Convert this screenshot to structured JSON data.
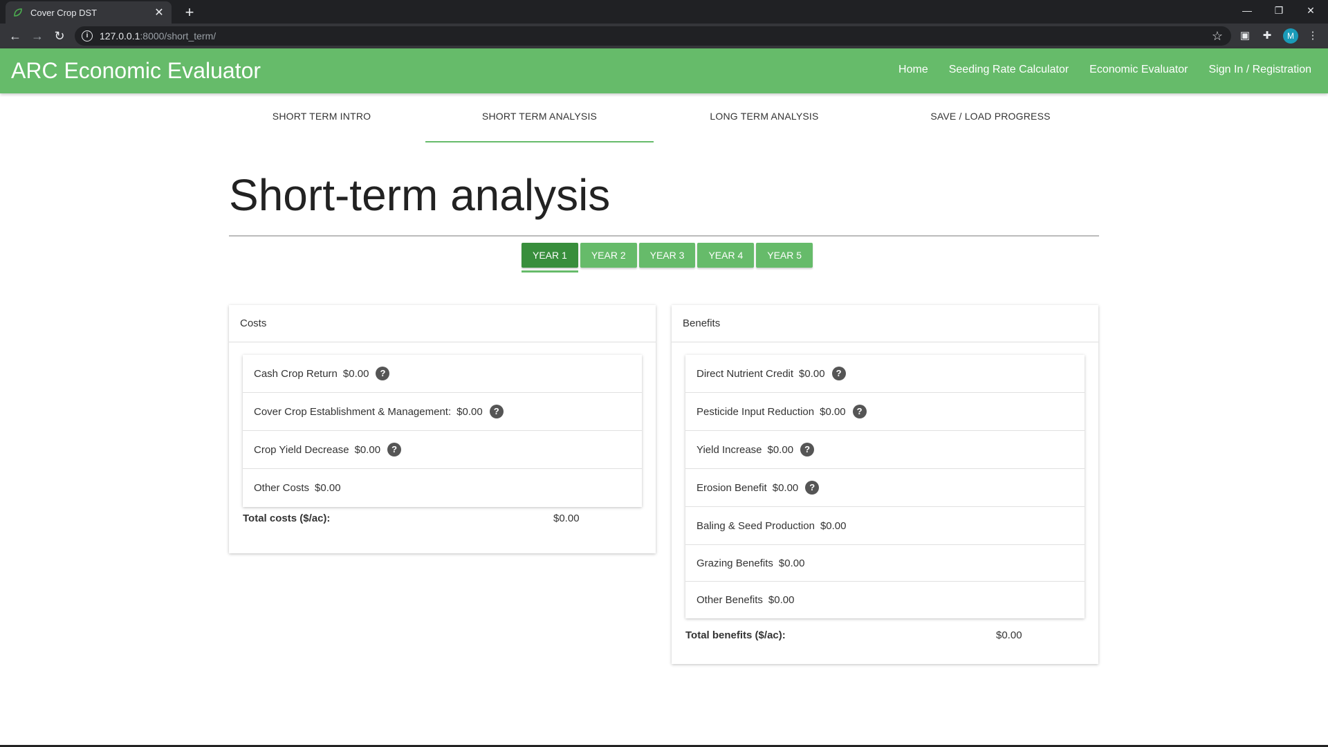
{
  "browser": {
    "tab_title": "Cover Crop DST",
    "tab_close": "✕",
    "new_tab": "+",
    "url_host": "127.0.0.1",
    "url_path": ":8000/short_term/",
    "profile_initial": "M"
  },
  "header": {
    "brand": "ARC Economic Evaluator",
    "links": [
      "Home",
      "Seeding Rate Calculator",
      "Economic Evaluator",
      "Sign In / Registration"
    ]
  },
  "subtabs": [
    "SHORT TERM INTRO",
    "SHORT TERM ANALYSIS",
    "LONG TERM ANALYSIS",
    "SAVE / LOAD PROGRESS"
  ],
  "active_subtab": "SHORT TERM ANALYSIS",
  "page_title": "Short-term analysis",
  "years": [
    "YEAR 1",
    "YEAR 2",
    "YEAR 3",
    "YEAR 4",
    "YEAR 5"
  ],
  "active_year": "YEAR 1",
  "costs": {
    "title": "Costs",
    "items": [
      {
        "label": "Cash Crop Return",
        "value": "$0.00",
        "help": "?"
      },
      {
        "label": "Cover Crop Establishment & Management:",
        "value": "$0.00",
        "help": "?"
      },
      {
        "label": "Crop Yield Decrease",
        "value": "$0.00",
        "help": "?"
      },
      {
        "label": "Other Costs",
        "value": "$0.00"
      }
    ],
    "total_label": "Total costs ($/ac):",
    "total_value": "$0.00"
  },
  "benefits": {
    "title": "Benefits",
    "items": [
      {
        "label": "Direct Nutrient Credit",
        "value": "$0.00",
        "help": "?"
      },
      {
        "label": "Pesticide Input Reduction",
        "value": "$0.00",
        "help": "?"
      },
      {
        "label": "Yield Increase",
        "value": "$0.00",
        "help": "?"
      },
      {
        "label": "Erosion Benefit",
        "value": "$0.00",
        "help": "?"
      },
      {
        "label": "Baling & Seed Production",
        "value": "$0.00"
      },
      {
        "label": "Grazing Benefits",
        "value": "$0.00"
      },
      {
        "label": "Other Benefits",
        "value": "$0.00"
      }
    ],
    "total_label": "Total benefits ($/ac):",
    "total_value": "$0.00"
  }
}
